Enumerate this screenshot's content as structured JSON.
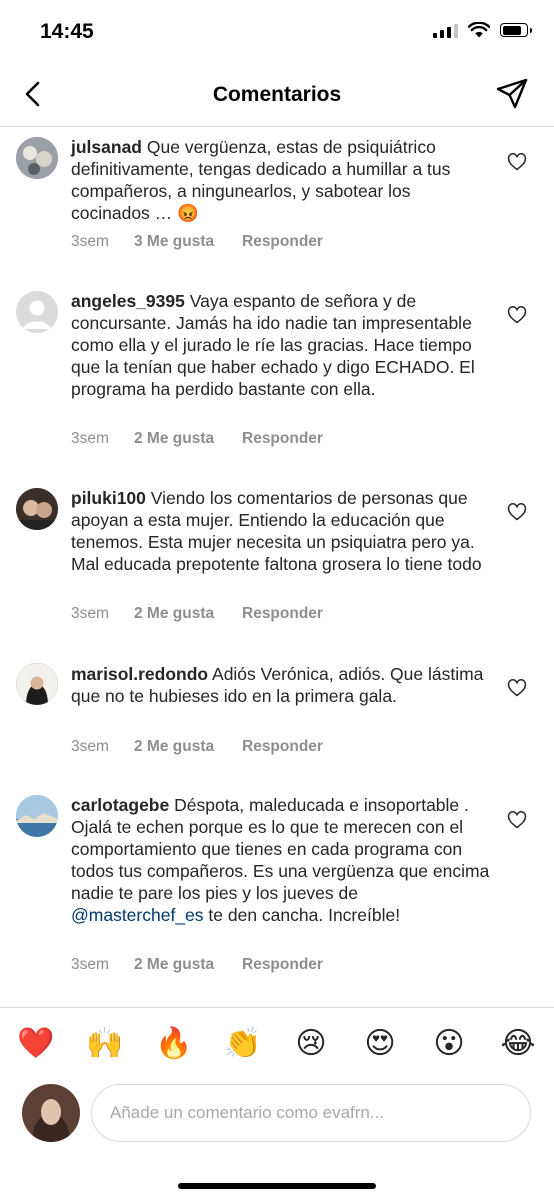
{
  "status_bar": {
    "time": "14:45"
  },
  "header": {
    "title": "Comentarios"
  },
  "comments": [
    {
      "username": "julsanad",
      "text": "Que vergüenza, estas de psiquiátrico definitivamente, tengas dedicado a humillar a tus compañeros, a ningunearlos, y sabotear los cocinados … 😡",
      "time": "3sem",
      "likes": "3 Me gusta",
      "reply": "Responder",
      "avatar_color": "#8a8f96"
    },
    {
      "username": "angeles_9395",
      "text": "Vaya espanto de señora y de concursante. Jamás ha ido nadie tan impresentable como ella y el jurado le ríe las gracias. Hace tiempo que la tenían que haber echado y digo ECHADO. El programa ha perdido bastante con ella.",
      "time": "3sem",
      "likes": "2 Me gusta",
      "reply": "Responder",
      "avatar_color": "#dbdbdb"
    },
    {
      "username": "piluki100",
      "text": "Viendo los comentarios de personas que apoyan a esta mujer. Entiendo la educación que tenemos. Esta mujer necesita un psiquiatra pero ya. Mal educada prepotente faltona grosera lo tiene todo",
      "time": "3sem",
      "likes": "2 Me gusta",
      "reply": "Responder",
      "avatar_color": "#5a4538"
    },
    {
      "username": "marisol.redondo",
      "text": "Adiós Verónica, adiós. Que lástima que no te hubieses ido en la primera gala.",
      "time": "3sem",
      "likes": "2 Me gusta",
      "reply": "Responder",
      "avatar_color": "#2a2a2a"
    },
    {
      "username": "carlotagebe",
      "text_before": "Déspota, maleducada e insoportable . Ojalá te echen porque es lo que te merecen con el comportamiento que tienes en cada programa con todos tus compañeros. Es una vergüenza que encima nadie te pare los pies y los jueves de ",
      "mention": "@masterchef_es",
      "text_after": "  te den cancha. Increíble!",
      "time": "3sem",
      "likes": "2 Me gusta",
      "reply": "Responder",
      "avatar_color": "#7fa9c9"
    }
  ],
  "emoji_bar": [
    "❤️",
    "🙌",
    "🔥",
    "👏",
    "😢",
    "😍",
    "😮",
    "😂"
  ],
  "input": {
    "placeholder": "Añade un comentario como evafrn..."
  },
  "icons": {
    "back": "chevron-left-icon",
    "share": "paper-plane-icon",
    "like": "heart-outline-icon"
  }
}
